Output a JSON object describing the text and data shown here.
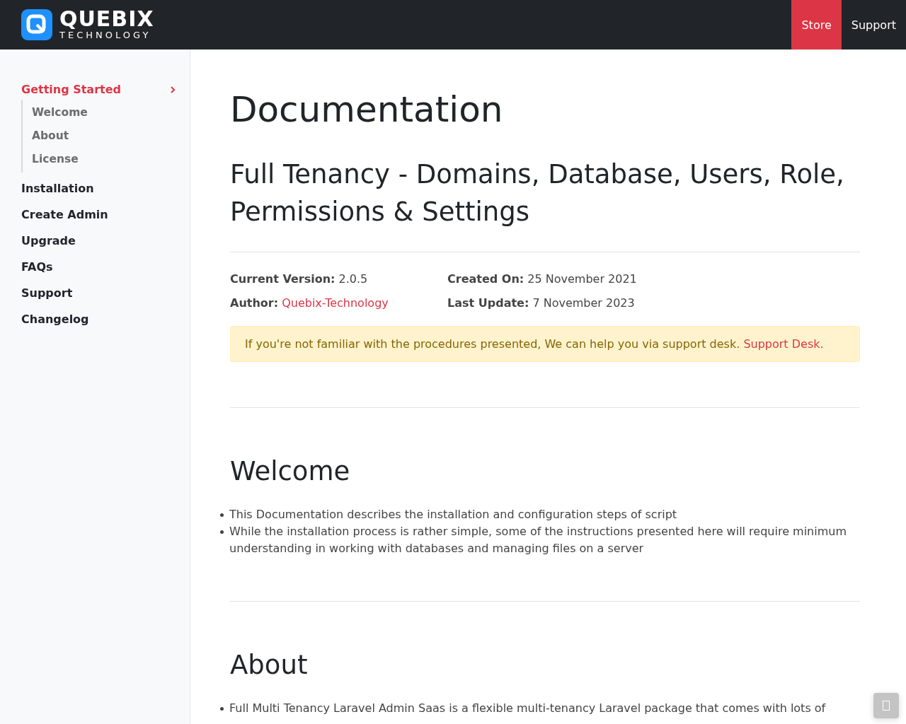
{
  "header": {
    "logo": {
      "name": "QUEBIX",
      "tagline": "TECHNOLOGY"
    },
    "nav": [
      {
        "label": "Store",
        "selected": true
      },
      {
        "label": "Support",
        "selected": false
      }
    ]
  },
  "sidebar": {
    "items": [
      {
        "label": "Getting Started",
        "selected": true,
        "expanded": true,
        "children": [
          {
            "label": "Welcome"
          },
          {
            "label": "About"
          },
          {
            "label": "License"
          }
        ]
      },
      {
        "label": "Installation",
        "selected": false,
        "expanded": false
      },
      {
        "label": "Create Admin",
        "selected": false,
        "expanded": false
      },
      {
        "label": "Upgrade",
        "selected": false,
        "expanded": false
      },
      {
        "label": "FAQs",
        "selected": false,
        "expanded": false
      },
      {
        "label": "Support",
        "selected": false,
        "expanded": false
      },
      {
        "label": "Changelog",
        "selected": false,
        "expanded": false
      }
    ]
  },
  "content": {
    "title": "Documentation",
    "subtitle": "Full Tenancy - Domains, Database, Users, Role, Permissions & Settings",
    "meta": [
      {
        "label": "Current Version:",
        "value": "2.0.5",
        "kind": "text"
      },
      {
        "label": "Created On:",
        "value": "25 November 2021",
        "kind": "text"
      },
      {
        "label": "Author:",
        "value": "Quebix-Technology",
        "kind": "link"
      },
      {
        "label": "Last Update:",
        "value": "7 November 2023",
        "kind": "text"
      }
    ],
    "notice": {
      "text": "If you're not familiar with the procedures presented, We can help you via support desk.",
      "link": "Support Desk."
    },
    "sections": [
      {
        "heading": "Welcome",
        "bullets": [
          "This Documentation describes the installation and configuration steps of script",
          "While the installation process is rather simple, some of the instructions presented here will require minimum understanding in working with databases and managing files on a server"
        ]
      },
      {
        "heading": "About",
        "bullets": [
          "Full Multi Tenancy Laravel Admin Saas is a flexible multi-tenancy Laravel package that comes with lots of"
        ]
      }
    ]
  }
}
